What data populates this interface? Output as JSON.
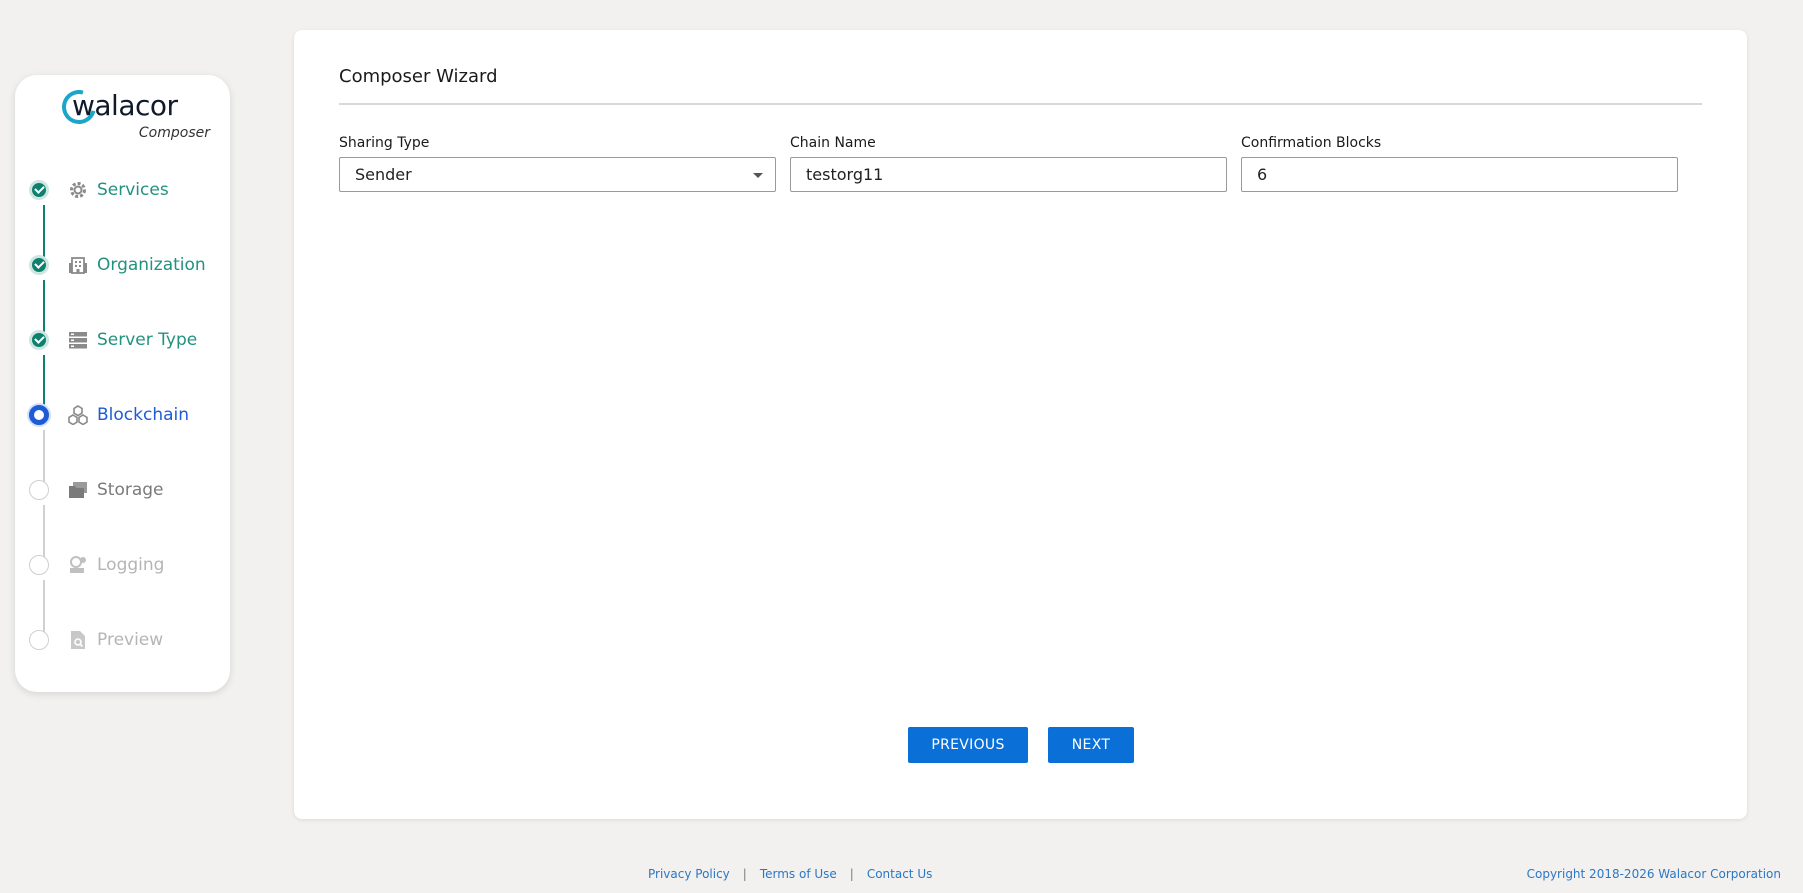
{
  "brand": {
    "name": "walacor",
    "subtitle": "Composer"
  },
  "steps": [
    {
      "label": "Services",
      "state": "done",
      "icon": "gear-icon"
    },
    {
      "label": "Organization",
      "state": "done",
      "icon": "building-icon"
    },
    {
      "label": "Server Type",
      "state": "done",
      "icon": "server-icon"
    },
    {
      "label": "Blockchain",
      "state": "active",
      "icon": "blockchain-icon"
    },
    {
      "label": "Storage",
      "state": "todo",
      "icon": "folders-icon"
    },
    {
      "label": "Logging",
      "state": "todo",
      "icon": "logging-icon"
    },
    {
      "label": "Preview",
      "state": "todo",
      "icon": "preview-icon"
    }
  ],
  "main": {
    "title": "Composer Wizard",
    "fields": {
      "sharing_type": {
        "label": "Sharing Type",
        "value": "Sender"
      },
      "chain_name": {
        "label": "Chain Name",
        "value": "testorg11"
      },
      "confirmation_blocks": {
        "label": "Confirmation Blocks",
        "value": "6"
      }
    },
    "buttons": {
      "previous": "PREVIOUS",
      "next": "NEXT"
    }
  },
  "footer": {
    "links": [
      "Privacy Policy",
      "Terms of Use",
      "Contact Us"
    ],
    "separator": "|",
    "copyright": "Copyright 2018-2026 Walacor Corporation"
  },
  "colors": {
    "done": "#0f7f6e",
    "active": "#1e5bd6",
    "primary_button": "#0a6fd6",
    "link": "#2a78c5"
  }
}
